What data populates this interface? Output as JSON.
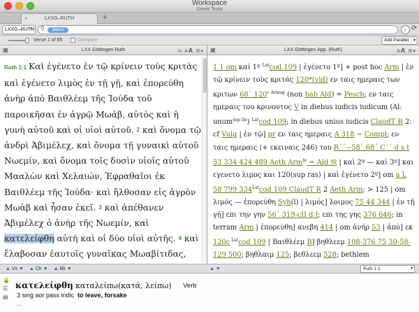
{
  "window": {
    "title": "Workspace",
    "subtitle": "Greek Texts"
  },
  "tabs": [
    {
      "label": "LXXG–RUTH"
    }
  ],
  "toolbar": {
    "resource": "LXXG–RUTH",
    "search_chip": "Biblical",
    "search_value": "",
    "verse_position": "Verse 1 of 85",
    "compare_label": "Compare",
    "add_parallel": "Add Parallel"
  },
  "left_pane": {
    "title": "LXX Göttingen Ruth",
    "ref": "Ruth 1:1",
    "v1a": "Καὶ ἐγένετο ἐν τῷ κρίνειν τοὺς κριτὰς καὶ ἐγένετο λιμὸς ἐν τῇ γῇ, καὶ ἐπορεύθη ἀνὴρ ἀπὸ Βαιθλέεμ τῆς Ἰούδα τοῦ παροικῆσαι ἐν ἀγρῷ Μωάβ, αὐτὸς καὶ ἡ γυνὴ αὐτοῦ καὶ οἱ υἱοὶ αὐτοῦ.",
    "v2num": "2",
    "v2": "καὶ ὄνομα τῷ ἀνδρὶ Ἀβιμέλεχ, καὶ ὄνομα τῇ γυναικὶ αὐτοῦ Νωεμίν, καὶ ὄνομα τοῖς δυσὶν υἱοῖς αὐτοῦ Μααλὼν καὶ Χελαιών, Ἐφραθαῖοι ἐκ Βαιθλέεμ τῆς Ἰούδα· καὶ ἤλθοσαν εἰς ἀγρὸν Μωὰβ καὶ ἦσαν ἐκεῖ.",
    "v3num": "3",
    "v3a": "καὶ ἀπέθανεν Ἀβιμέλεχ ὁ ἀνὴρ τῆς Νωεμίν, καὶ",
    "v3hl": "κατελείφθη",
    "v3b": "αὐτὴ καὶ οἱ δύο υἱοὶ αὐτῆς.",
    "v4num": "4",
    "v4": "καὶ ἔλαβοσαν ἑαυτοῖς γυναῖκας Μωαβίτιδας, ὄνομα τῇ μιᾷ Ὀρφά, καὶ ὄνομα τῇ δευτέρᾳ Ῥούθ· καὶ"
  },
  "right_pane": {
    "title": "LXX Göttingen App. (Ruth)",
    "l01": "1 1 om",
    "l02": " καὶ 1º ",
    "l03": "Lat",
    "l04": "cod 109",
    "l05": " | ἐγένετο 1º] + post hoc ",
    "l06": "Arm",
    "l07": " | ἐν τῷ κρίνειν τοὺς κριτάς ",
    "l08": "120*(vid)",
    "l09": " εν ταις ημεραις των κριτων ",
    "l10": "68΄ 120",
    "l11": "c Arm",
    "l12": "ap",
    "l13": " (non ",
    "l14": "hab Ald",
    "l15": ") = ",
    "l16": "Pesch",
    "l17": "; εν ταις ημεραις του κρινοντος ",
    "l18": "V",
    "l19": " in diebus iudicis iudicum (Al: unum",
    "l20": "sup lin",
    "l21": ") ",
    "l22": "Lat",
    "l23": "cod 109",
    "l24": "; in diebus unius iudicis ",
    "l25": "ClaudT R",
    "l26": " 2: cf ",
    "l27": "Vulg",
    "l28": " | ἐν τῷ] ",
    "l29": "pr",
    "l30": " εν ταις ημεραις ",
    "l31": "A 318",
    "l32": " − ",
    "l33": "Compl",
    "l34": "; εν ταις ημεραις (+ εκειναις 246) του ",
    "l35": "R΄΄−",
    "l36": "58΄ 68΄ C΄΄ d s t 53 334 424 489 Aeth Arm",
    "l37": "te",
    "l38": " = Ald 𝔐",
    "l39": " | καὶ 2º — καὶ 3º] και εγενετο λιμος και 120(sup ras) | καὶ ἐγένετο 2º] om ",
    "l40": "a L 58 799 334",
    "l41": "Lat",
    "l42": "cod 109 ClaudT R",
    "l43": " 2 ",
    "l44": "Aeth Arm",
    "l45": "; > 125 | om λιμός — ἐπορεύθη ",
    "l46": "Syh",
    "l47": "(l) | λιμός] λοιμος ",
    "l48": "75 44 344",
    "l49": " | ἐν τῇ γῇ] επι την γην ",
    "l50": "56΄ 319",
    "l51": "-cII d f",
    "l52": "; επι της γης ",
    "l53": "376 646",
    "l54": "; in terram ",
    "l55": "Arm",
    "l56": " | ἐπορεύθη] ανεβη ",
    "l57": "414",
    "l58": " | om ἀνήρ ",
    "l59": "53",
    "l60": " | ἀπὸ] εκ ",
    "l61": "120c",
    "l62": " Lat",
    "l63": "cod 109",
    "l64": " | Βαιθλέεμ ",
    "l65": "B",
    "l66": "] βηθλεεμ ",
    "l67": "108-376 75",
    "l68": " 30-58-129 500",
    "l69": "; βηθλαιμ ",
    "l70": "125",
    "l71": "; βεθλεεμ ",
    "l72": "528",
    "l73": "; bethlem"
  },
  "bottombar": {
    "nav1": "Vs",
    "nav2": "Ch",
    "nav3": "Bk",
    "ref_select": "Ruth 1:1"
  },
  "info": {
    "word": "κατελείφθη",
    "lemma": "καταλείπω(κατά, λείπω)",
    "pos": "Verb",
    "parse": "3 sing aor pass indic",
    "gloss": "to leave, forsake",
    "dash": "--"
  }
}
